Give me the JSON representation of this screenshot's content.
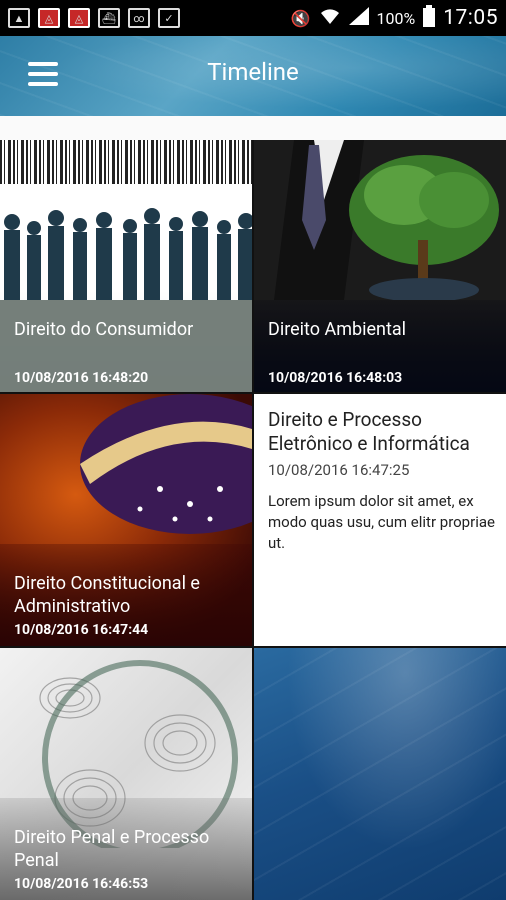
{
  "status_bar": {
    "battery": "100%",
    "time": "17:05"
  },
  "app_bar": {
    "title": "Timeline"
  },
  "tiles": [
    {
      "title": "Direito do Consumidor",
      "date": "10/08/2016 16:48:20"
    },
    {
      "title": "Direito Ambiental",
      "date": "10/08/2016 16:48:03"
    },
    {
      "title": "Direito Constitucional e Administrativo",
      "date": "10/08/2016 16:47:44"
    },
    {
      "title": "Direito e Processo Eletrônico e Informática",
      "date": "10/08/2016 16:47:25",
      "body": "Lorem ipsum dolor sit amet, ex modo quas usu, cum elitr propriae ut."
    },
    {
      "title": "Direito Penal e Processo Penal",
      "date": "10/08/2016 16:46:53"
    },
    {
      "title": "",
      "date": ""
    }
  ],
  "icons": {
    "menu": "hamburger-menu-icon",
    "signal": "signal-icon",
    "wifi": "wifi-icon",
    "battery": "battery-icon",
    "mute": "mute-icon"
  },
  "colors": {
    "app_bar": "#3a8fb8",
    "consumer_overlay": "#6e7873",
    "environment_overlay": "#050814",
    "constitutional_overlay": "#2a0404",
    "penal_overlay": "#646464",
    "blue_tile": "#1a4f86"
  }
}
